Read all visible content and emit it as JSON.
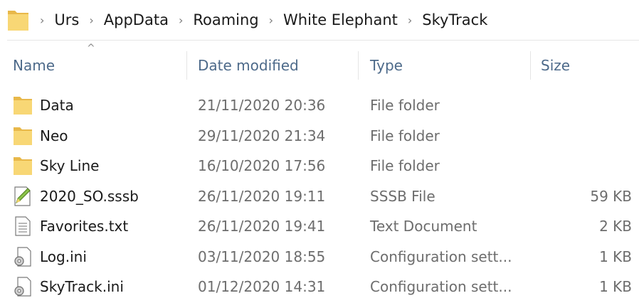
{
  "breadcrumb": {
    "items": [
      "Urs",
      "AppData",
      "Roaming",
      "White Elephant",
      "SkyTrack"
    ],
    "separator": "›"
  },
  "columns": {
    "name": "Name",
    "date": "Date modified",
    "type": "Type",
    "size": "Size"
  },
  "files": [
    {
      "name": "Data",
      "date": "21/11/2020 20:36",
      "type": "File folder",
      "size": "",
      "icon": "folder-icon"
    },
    {
      "name": "Neo",
      "date": "29/11/2020 21:34",
      "type": "File folder",
      "size": "",
      "icon": "folder-icon"
    },
    {
      "name": "Sky Line",
      "date": "16/10/2020 17:56",
      "type": "File folder",
      "size": "",
      "icon": "folder-icon"
    },
    {
      "name": "2020_SO.sssb",
      "date": "26/11/2020 19:11",
      "type": "SSSB File",
      "size": "59 KB",
      "icon": "sssb-file-icon"
    },
    {
      "name": "Favorites.txt",
      "date": "26/11/2020 19:41",
      "type": "Text Document",
      "size": "2 KB",
      "icon": "text-file-icon"
    },
    {
      "name": "Log.ini",
      "date": "03/11/2020 18:55",
      "type": "Configuration sett...",
      "size": "1 KB",
      "icon": "config-file-icon"
    },
    {
      "name": "SkyTrack.ini",
      "date": "01/12/2020 14:31",
      "type": "Configuration sett...",
      "size": "1 KB",
      "icon": "config-file-icon"
    }
  ],
  "colors": {
    "folder": "#f8d775",
    "folder_dark": "#e8b84a",
    "header_text": "#4d6a8a"
  }
}
